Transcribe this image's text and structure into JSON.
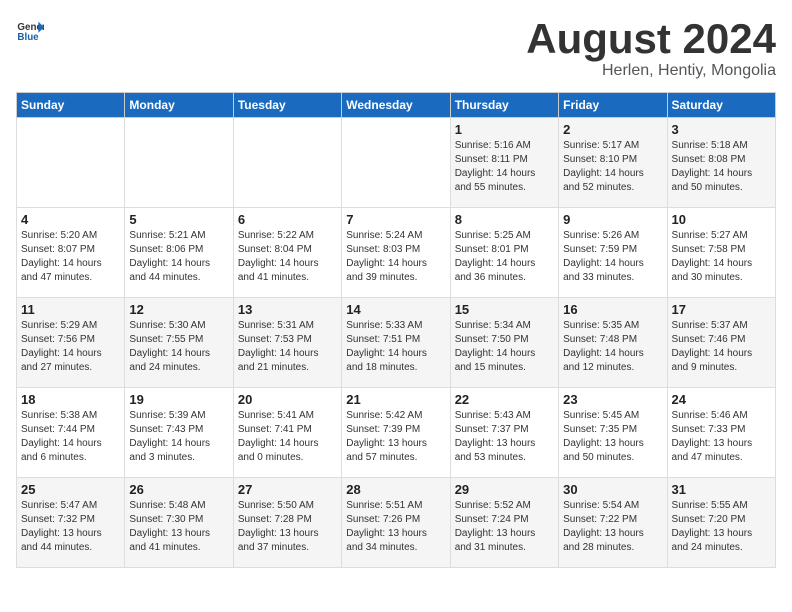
{
  "header": {
    "logo_general": "General",
    "logo_blue": "Blue",
    "title": "August 2024",
    "subtitle": "Herlen, Hentiy, Mongolia"
  },
  "calendar": {
    "days_of_week": [
      "Sunday",
      "Monday",
      "Tuesday",
      "Wednesday",
      "Thursday",
      "Friday",
      "Saturday"
    ],
    "weeks": [
      [
        {
          "day": "",
          "info": ""
        },
        {
          "day": "",
          "info": ""
        },
        {
          "day": "",
          "info": ""
        },
        {
          "day": "",
          "info": ""
        },
        {
          "day": "1",
          "info": "Sunrise: 5:16 AM\nSunset: 8:11 PM\nDaylight: 14 hours\nand 55 minutes."
        },
        {
          "day": "2",
          "info": "Sunrise: 5:17 AM\nSunset: 8:10 PM\nDaylight: 14 hours\nand 52 minutes."
        },
        {
          "day": "3",
          "info": "Sunrise: 5:18 AM\nSunset: 8:08 PM\nDaylight: 14 hours\nand 50 minutes."
        }
      ],
      [
        {
          "day": "4",
          "info": "Sunrise: 5:20 AM\nSunset: 8:07 PM\nDaylight: 14 hours\nand 47 minutes."
        },
        {
          "day": "5",
          "info": "Sunrise: 5:21 AM\nSunset: 8:06 PM\nDaylight: 14 hours\nand 44 minutes."
        },
        {
          "day": "6",
          "info": "Sunrise: 5:22 AM\nSunset: 8:04 PM\nDaylight: 14 hours\nand 41 minutes."
        },
        {
          "day": "7",
          "info": "Sunrise: 5:24 AM\nSunset: 8:03 PM\nDaylight: 14 hours\nand 39 minutes."
        },
        {
          "day": "8",
          "info": "Sunrise: 5:25 AM\nSunset: 8:01 PM\nDaylight: 14 hours\nand 36 minutes."
        },
        {
          "day": "9",
          "info": "Sunrise: 5:26 AM\nSunset: 7:59 PM\nDaylight: 14 hours\nand 33 minutes."
        },
        {
          "day": "10",
          "info": "Sunrise: 5:27 AM\nSunset: 7:58 PM\nDaylight: 14 hours\nand 30 minutes."
        }
      ],
      [
        {
          "day": "11",
          "info": "Sunrise: 5:29 AM\nSunset: 7:56 PM\nDaylight: 14 hours\nand 27 minutes."
        },
        {
          "day": "12",
          "info": "Sunrise: 5:30 AM\nSunset: 7:55 PM\nDaylight: 14 hours\nand 24 minutes."
        },
        {
          "day": "13",
          "info": "Sunrise: 5:31 AM\nSunset: 7:53 PM\nDaylight: 14 hours\nand 21 minutes."
        },
        {
          "day": "14",
          "info": "Sunrise: 5:33 AM\nSunset: 7:51 PM\nDaylight: 14 hours\nand 18 minutes."
        },
        {
          "day": "15",
          "info": "Sunrise: 5:34 AM\nSunset: 7:50 PM\nDaylight: 14 hours\nand 15 minutes."
        },
        {
          "day": "16",
          "info": "Sunrise: 5:35 AM\nSunset: 7:48 PM\nDaylight: 14 hours\nand 12 minutes."
        },
        {
          "day": "17",
          "info": "Sunrise: 5:37 AM\nSunset: 7:46 PM\nDaylight: 14 hours\nand 9 minutes."
        }
      ],
      [
        {
          "day": "18",
          "info": "Sunrise: 5:38 AM\nSunset: 7:44 PM\nDaylight: 14 hours\nand 6 minutes."
        },
        {
          "day": "19",
          "info": "Sunrise: 5:39 AM\nSunset: 7:43 PM\nDaylight: 14 hours\nand 3 minutes."
        },
        {
          "day": "20",
          "info": "Sunrise: 5:41 AM\nSunset: 7:41 PM\nDaylight: 14 hours\nand 0 minutes."
        },
        {
          "day": "21",
          "info": "Sunrise: 5:42 AM\nSunset: 7:39 PM\nDaylight: 13 hours\nand 57 minutes."
        },
        {
          "day": "22",
          "info": "Sunrise: 5:43 AM\nSunset: 7:37 PM\nDaylight: 13 hours\nand 53 minutes."
        },
        {
          "day": "23",
          "info": "Sunrise: 5:45 AM\nSunset: 7:35 PM\nDaylight: 13 hours\nand 50 minutes."
        },
        {
          "day": "24",
          "info": "Sunrise: 5:46 AM\nSunset: 7:33 PM\nDaylight: 13 hours\nand 47 minutes."
        }
      ],
      [
        {
          "day": "25",
          "info": "Sunrise: 5:47 AM\nSunset: 7:32 PM\nDaylight: 13 hours\nand 44 minutes."
        },
        {
          "day": "26",
          "info": "Sunrise: 5:48 AM\nSunset: 7:30 PM\nDaylight: 13 hours\nand 41 minutes."
        },
        {
          "day": "27",
          "info": "Sunrise: 5:50 AM\nSunset: 7:28 PM\nDaylight: 13 hours\nand 37 minutes."
        },
        {
          "day": "28",
          "info": "Sunrise: 5:51 AM\nSunset: 7:26 PM\nDaylight: 13 hours\nand 34 minutes."
        },
        {
          "day": "29",
          "info": "Sunrise: 5:52 AM\nSunset: 7:24 PM\nDaylight: 13 hours\nand 31 minutes."
        },
        {
          "day": "30",
          "info": "Sunrise: 5:54 AM\nSunset: 7:22 PM\nDaylight: 13 hours\nand 28 minutes."
        },
        {
          "day": "31",
          "info": "Sunrise: 5:55 AM\nSunset: 7:20 PM\nDaylight: 13 hours\nand 24 minutes."
        }
      ]
    ]
  }
}
